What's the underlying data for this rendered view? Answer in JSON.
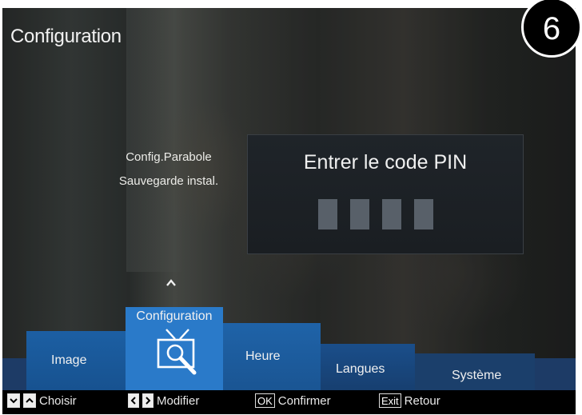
{
  "header": {
    "title": "Configuration"
  },
  "badge": {
    "number": "6"
  },
  "submenu": {
    "items": [
      "Config.Parabole",
      "Sauvegarde instal."
    ]
  },
  "pin_dialog": {
    "title": "Entrer le code PIN",
    "digit_count": 4
  },
  "tabs": [
    {
      "label": "Image"
    },
    {
      "label": "Configuration",
      "selected": true,
      "icon": "tv-search-icon"
    },
    {
      "label": "Heure"
    },
    {
      "label": "Langues"
    },
    {
      "label": "Système"
    }
  ],
  "help": {
    "choose": "Choisir",
    "modify": "Modifier",
    "ok_key": "OK",
    "confirm": "Confirmer",
    "exit_key": "Exit",
    "back": "Retour"
  },
  "colors": {
    "tab_selected": "#2a7ac9",
    "tab_bar": "#1d3b66",
    "pin_box": "#1f2429"
  }
}
